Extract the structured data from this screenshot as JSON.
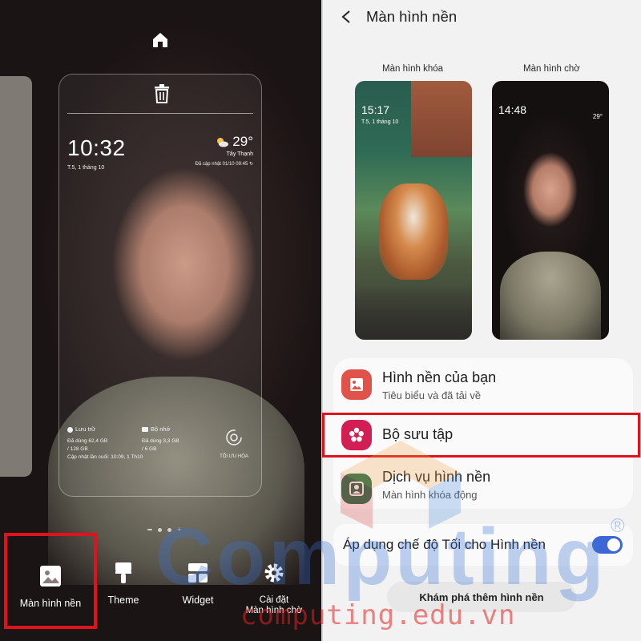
{
  "left": {
    "lock_preview": {
      "time": "10:32",
      "date": "T.5, 1 tháng 10",
      "weather_temp": "29°",
      "weather_location": "Tây Thạnh",
      "weather_updated": "Đã cập nhật 01/10 09:45",
      "storage_title": "Lưu trữ",
      "storage_used": "Đã dùng 62,4 GB",
      "storage_total": "/ 128 GB",
      "storage_updated": "Cập nhật lần cuối: 10:09, 1 Th10",
      "memory_title": "Bộ nhớ",
      "memory_used": "Đã dùng 3,3 GB",
      "memory_total": "/ 6 GB",
      "optimize_label": "TỐI ƯU HÓA"
    },
    "bottom_bar": {
      "wallpaper": "Màn hình nền",
      "theme": "Theme",
      "widget": "Widget",
      "settings_line1": "Cài đặt",
      "settings_line2": "Màn hình chờ"
    }
  },
  "right": {
    "title": "Màn hình nền",
    "lock_screen_label": "Màn hình khóa",
    "home_screen_label": "Màn hình chờ",
    "lock_thumb": {
      "time": "15:17",
      "date": "T.5, 1 tháng 10"
    },
    "home_thumb": {
      "time": "14:48",
      "weather": "29°"
    },
    "menu": {
      "yours_title": "Hình nền của bạn",
      "yours_sub": "Tiêu biểu và đã tải về",
      "gallery_title": "Bộ sưu tập",
      "service_title": "Dịch vụ hình nền",
      "service_sub": "Màn hình khóa động"
    },
    "dark_mode_label": "Áp dụng chế độ Tối cho Hình nền",
    "dark_mode_on": true,
    "explore_button": "Khám phá thêm hình nền"
  },
  "watermark": {
    "word": "Computing",
    "url": "computing.edu.vn",
    "registered": "®"
  },
  "colors": {
    "highlight_red": "#e0131c",
    "toggle_blue": "#3d67d6",
    "gallery_icon": "#d11f55",
    "yours_icon": "#e0524a",
    "service_icon": "#1f6b4c"
  }
}
